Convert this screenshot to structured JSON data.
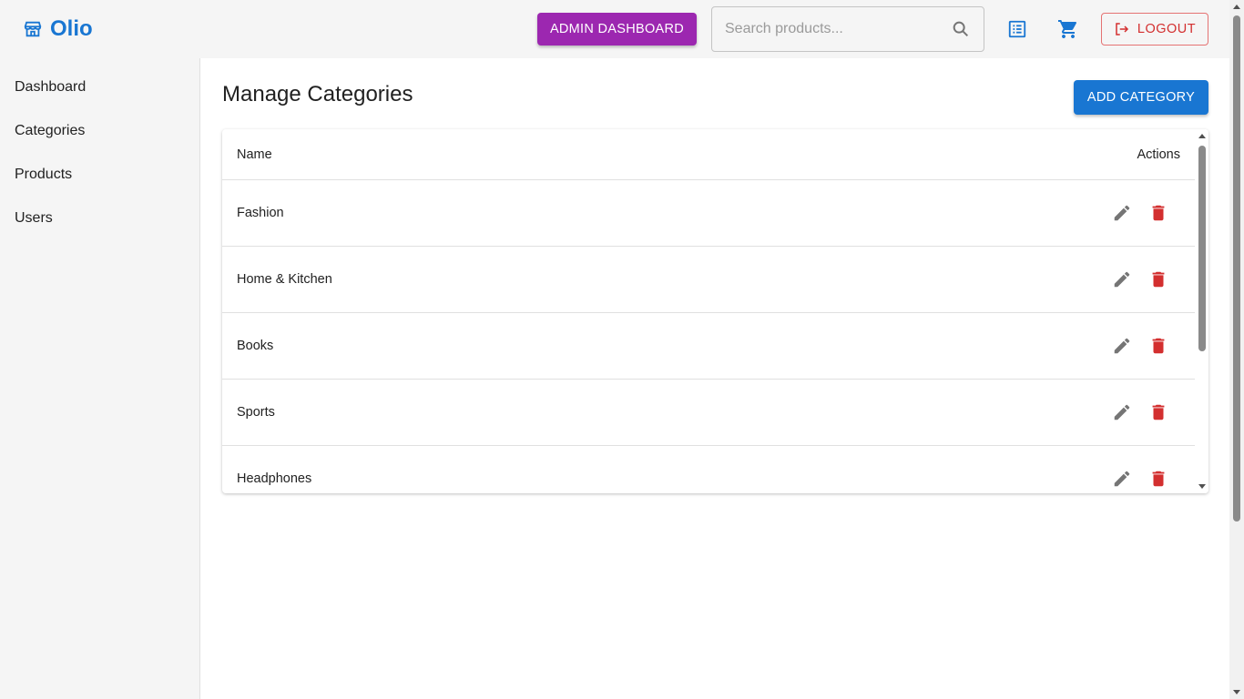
{
  "header": {
    "brand": "Olio",
    "admin_label": "ADMIN DASHBOARD",
    "search_placeholder": "Search products...",
    "search_value": "",
    "logout_label": "LOGOUT",
    "icons": {
      "brand": "storefront-icon",
      "search": "search-icon",
      "orders": "list-alt-icon",
      "cart": "shopping-cart-icon",
      "logout": "logout-icon"
    }
  },
  "sidebar": {
    "items": [
      {
        "label": "Dashboard"
      },
      {
        "label": "Categories"
      },
      {
        "label": "Products"
      },
      {
        "label": "Users"
      }
    ]
  },
  "main": {
    "title": "Manage Categories",
    "add_label": "ADD CATEGORY",
    "table": {
      "columns": [
        "Name",
        "Actions"
      ],
      "rows": [
        {
          "name": "Fashion"
        },
        {
          "name": "Home & Kitchen"
        },
        {
          "name": "Books"
        },
        {
          "name": "Sports"
        },
        {
          "name": "Headphones"
        }
      ]
    }
  },
  "colors": {
    "primary": "#1976d2",
    "admin": "#9c27b0",
    "danger": "#d32f2f",
    "edit_icon": "#757575"
  }
}
